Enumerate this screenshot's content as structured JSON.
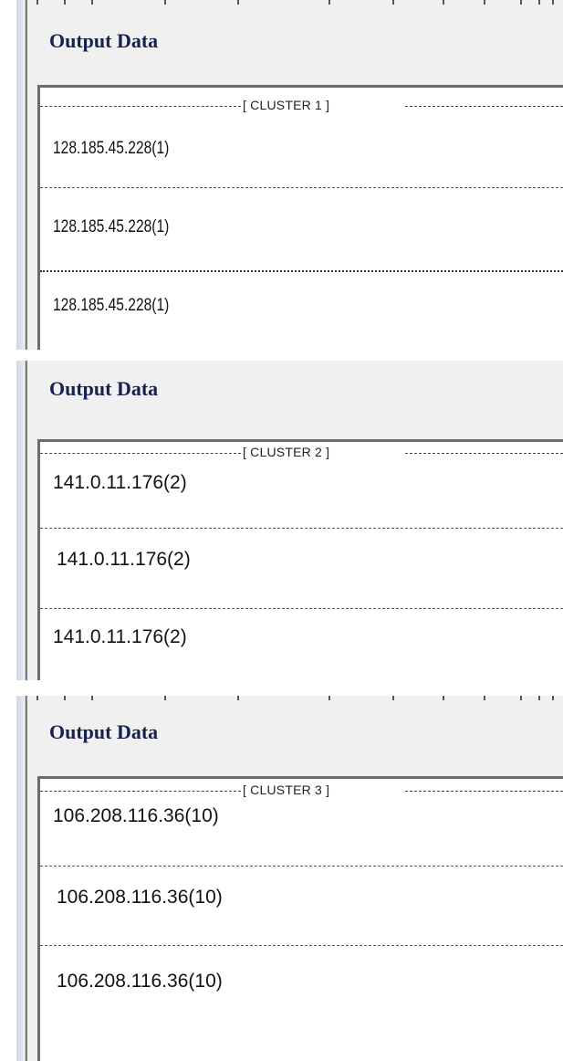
{
  "panels": [
    {
      "title": "Output  Data",
      "cluster_header": "[ CLUSTER 1 ]",
      "rows": [
        "128.185.45.228(1)",
        "128.185.45.228(1)",
        "128.185.45.228(1)"
      ]
    },
    {
      "title": "Output  Data",
      "cluster_header": "[ CLUSTER 2 ]",
      "rows": [
        "141.0.11.176(2)",
        "141.0.11.176(2)",
        "141.0.11.176(2)"
      ]
    },
    {
      "title": "Output  Data",
      "cluster_header": "[ CLUSTER 3 ]",
      "rows": [
        "106.208.116.36(10)",
        "106.208.116.36(10)",
        "106.208.116.36(10)"
      ]
    }
  ]
}
